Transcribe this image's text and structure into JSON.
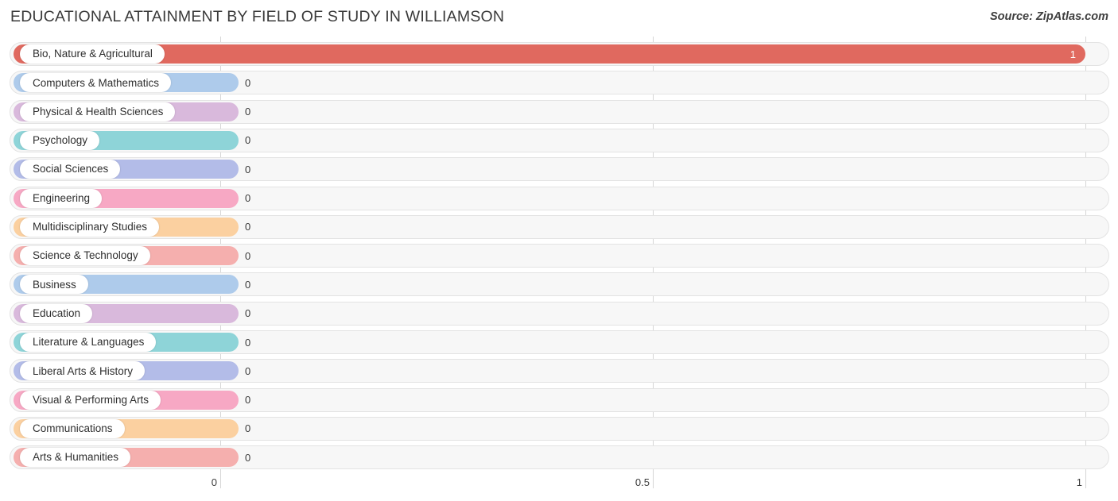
{
  "header": {
    "title": "EDUCATIONAL ATTAINMENT BY FIELD OF STUDY IN WILLIAMSON",
    "source": "Source: ZipAtlas.com"
  },
  "chart_data": {
    "type": "bar",
    "orientation": "horizontal",
    "title": "EDUCATIONAL ATTAINMENT BY FIELD OF STUDY IN WILLIAMSON",
    "xlabel": "",
    "ylabel": "",
    "xlim": [
      0,
      1
    ],
    "grid": true,
    "legend": "none",
    "axis_ticks": [
      "0",
      "0.5",
      "1"
    ],
    "axis_tick_values": [
      0,
      0.5,
      1
    ],
    "categories": [
      "Bio, Nature & Agricultural",
      "Computers & Mathematics",
      "Physical & Health Sciences",
      "Psychology",
      "Social Sciences",
      "Engineering",
      "Multidisciplinary Studies",
      "Science & Technology",
      "Business",
      "Education",
      "Literature & Languages",
      "Liberal Arts & History",
      "Visual & Performing Arts",
      "Communications",
      "Arts & Humanities"
    ],
    "values": [
      1,
      0,
      0,
      0,
      0,
      0,
      0,
      0,
      0,
      0,
      0,
      0,
      0,
      0,
      0
    ],
    "value_labels": [
      "1",
      "0",
      "0",
      "0",
      "0",
      "0",
      "0",
      "0",
      "0",
      "0",
      "0",
      "0",
      "0",
      "0",
      "0"
    ],
    "colors": [
      "#e0695f",
      "#aecbeb",
      "#d9b9dc",
      "#8ed4d8",
      "#b3bce8",
      "#f7a8c4",
      "#fbd0a0",
      "#f5afae",
      "#aecbeb",
      "#d9b9dc",
      "#8ed4d8",
      "#b3bce8",
      "#f7a8c4",
      "#fbd0a0",
      "#f5afae"
    ]
  }
}
